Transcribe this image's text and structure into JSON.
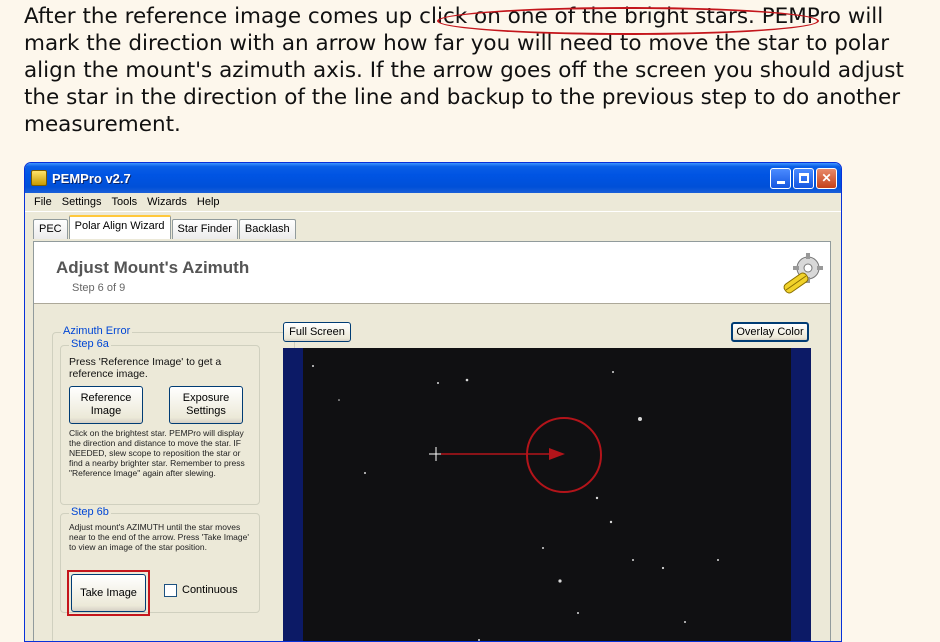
{
  "intro": {
    "part1": "After the reference image comes up ",
    "highlight": "click on one of the bright stars.",
    "part2": " PEMPro will mark the direction with an arrow how far you will need to move the star to polar align the mount's azimuth axis. If the arrow goes off the screen you should adjust the star in the direction of the line and backup to the previous step to do another measurement."
  },
  "window": {
    "title": "PEMPro v2.7",
    "menu": [
      "File",
      "Settings",
      "Tools",
      "Wizards",
      "Help"
    ],
    "tabs": [
      {
        "label": "PEC",
        "active": false
      },
      {
        "label": "Polar Align Wizard",
        "active": true
      },
      {
        "label": "Star Finder",
        "active": false
      },
      {
        "label": "Backlash",
        "active": false
      }
    ]
  },
  "wizard": {
    "title": "Adjust Mount's Azimuth",
    "step": "Step 6 of 9"
  },
  "azimuth_group": {
    "label": "Azimuth Error",
    "step6a": {
      "label": "Step 6a",
      "instruction": "Press 'Reference Image' to get a reference image.",
      "ref_button": "Reference Image",
      "exposure_button": "Exposure Settings",
      "details": "Click on the brightest star.  PEMPro will display the direction and distance to move the star. IF NEEDED, slew scope to reposition the star or find a nearby brighter star. Remember to press \"Reference Image\" again after slewing."
    },
    "step6b": {
      "label": "Step 6b",
      "instruction": "Adjust mount's AZIMUTH until the star moves near to the end of the arrow. Press 'Take Image' to view an image of the star position.",
      "take_button": "Take Image",
      "continuous_label": "Continuous"
    }
  },
  "image_panel": {
    "full_screen_button": "Full Screen",
    "overlay_color_button": "Overlay Color"
  },
  "colors": {
    "highlight_red": "#c4161c",
    "xp_title_blue": "#0054e3",
    "starfield_border": "#0c1a66"
  }
}
